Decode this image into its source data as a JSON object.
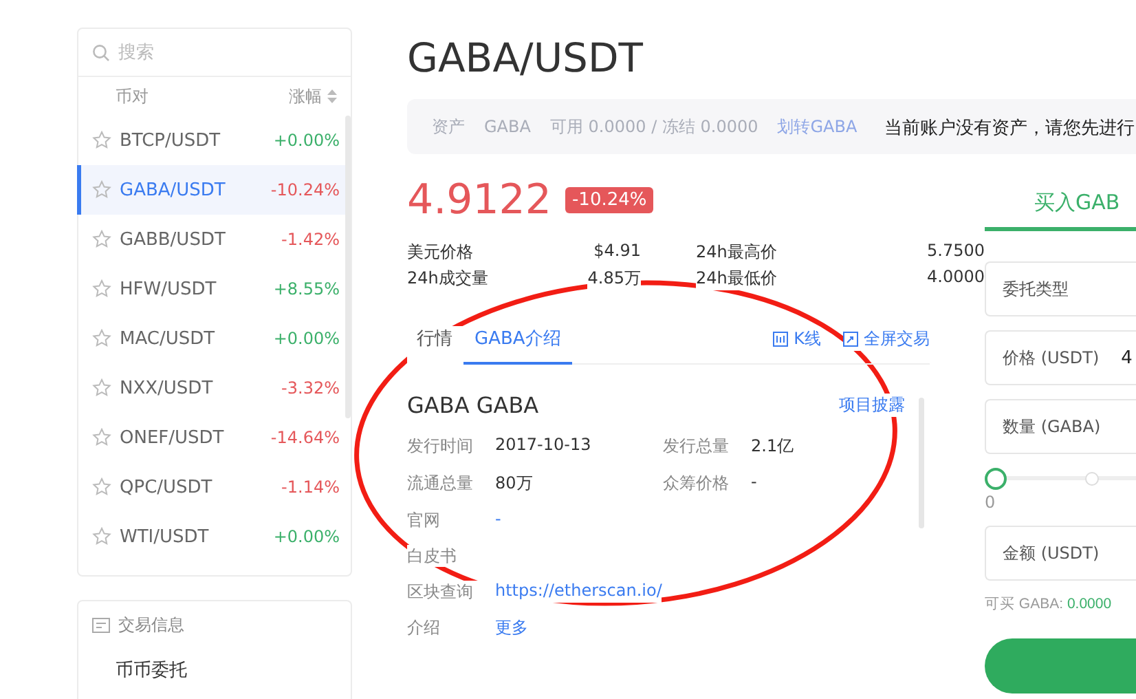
{
  "sidebar": {
    "search": {
      "placeholder": "搜索"
    },
    "columns": [
      "币对",
      "涨幅"
    ],
    "pairs": [
      {
        "name": "BTCP/USDT",
        "change": "+0.00%",
        "rising": true,
        "selected": false
      },
      {
        "name": "GABA/USDT",
        "change": "-10.24%",
        "rising": false,
        "selected": true
      },
      {
        "name": "GABB/USDT",
        "change": "-1.42%",
        "rising": false,
        "selected": false
      },
      {
        "name": "HFW/USDT",
        "change": "+8.55%",
        "rising": true,
        "selected": false
      },
      {
        "name": "MAC/USDT",
        "change": "+0.00%",
        "rising": true,
        "selected": false
      },
      {
        "name": "NXX/USDT",
        "change": "-3.32%",
        "rising": false,
        "selected": false
      },
      {
        "name": "ONEF/USDT",
        "change": "-14.64%",
        "rising": false,
        "selected": false
      },
      {
        "name": "QPC/USDT",
        "change": "-1.14%",
        "rising": false,
        "selected": false
      },
      {
        "name": "WTI/USDT",
        "change": "+0.00%",
        "rising": true,
        "selected": false
      }
    ],
    "info_card": {
      "title": "交易信息",
      "items": [
        "币币委托"
      ]
    }
  },
  "main": {
    "title": "GABA/USDT",
    "assets_bar": {
      "texts": [
        "资产",
        "GABA",
        "可用 0.0000 / 冻结 0.0000"
      ],
      "link": "划转GABA",
      "notice": "当前账户没有资产，请您先进行"
    },
    "price": {
      "value": "4.9122",
      "change": "-10.24%",
      "rising": false
    },
    "stats": [
      {
        "label": "美元价格",
        "value": "$4.91"
      },
      {
        "label": "24h最高价",
        "value": "5.7500"
      },
      {
        "label": "24h成交量",
        "value": "4.85万"
      },
      {
        "label": "24h最低价",
        "value": "4.0000"
      }
    ],
    "tabs": [
      {
        "label": "行情",
        "selected": false
      },
      {
        "label": "GABA介绍",
        "selected": true
      }
    ],
    "links": [
      "K线",
      "全屏交易"
    ],
    "intro": {
      "title": "GABA GABA",
      "disclosure": "项目披露",
      "facts": [
        {
          "label": "发行时间",
          "value": "2017-10-13"
        },
        {
          "label": "发行总量",
          "value": "2.1亿"
        },
        {
          "label": "流通总量",
          "value": "80万"
        },
        {
          "label": "众筹价格",
          "value": "-"
        }
      ],
      "rows": [
        {
          "label": "官网",
          "value": "-",
          "kind": "link"
        },
        {
          "label": "白皮书",
          "kind": "empty"
        },
        {
          "label": "区块查询",
          "value": "https://etherscan.io/",
          "kind": "link"
        },
        {
          "label": "介绍",
          "value": "更多",
          "kind": "link"
        }
      ]
    }
  },
  "trade": {
    "tab": "买入GAB",
    "fields": [
      {
        "label": "委托类型"
      },
      {
        "label": "价格 (USDT)",
        "value": "4"
      },
      {
        "label": "数量 (GABA)"
      }
    ],
    "slider": {
      "level": 0,
      "marks": [
        "0"
      ]
    },
    "amount": {
      "label": "金额 (USDT)"
    },
    "available": {
      "label": "可买 GABA:",
      "value": "0.0000"
    }
  },
  "annotations": [
    {
      "kind": "ellipse"
    }
  ]
}
